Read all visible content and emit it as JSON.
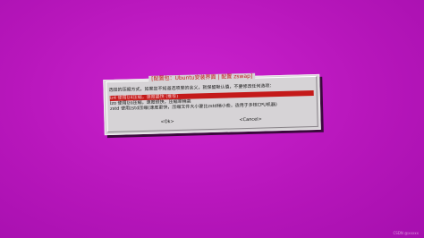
{
  "dialog": {
    "title": "[配置包：Ubuntu安装界面 | 配置 zswap]",
    "prompt": "选择的压缩方式，如果您不知道选项里的含义，就保留默认值，不要修改任何选项：",
    "items": [
      {
        "label": "lz4 使用lz4压缩，速度最快 (推荐)",
        "selected": true
      },
      {
        "label": "lzo 使用lzo压缩，速度很快，压缩率稍高",
        "selected": false
      },
      {
        "label": "zstd 使用zstd压缩(速度更快，压缩文件大小要比zstd稍小些，适用于多核CPU机器)",
        "selected": false
      }
    ],
    "ok_label": "<Ok>",
    "cancel_label": "<Cancel>"
  },
  "watermark": "CSDN @xxxxx",
  "colors": {
    "background": "#c01ac4",
    "dialog": "#d6d3d6",
    "selection": "#c41a1a",
    "title": "#c21616"
  }
}
